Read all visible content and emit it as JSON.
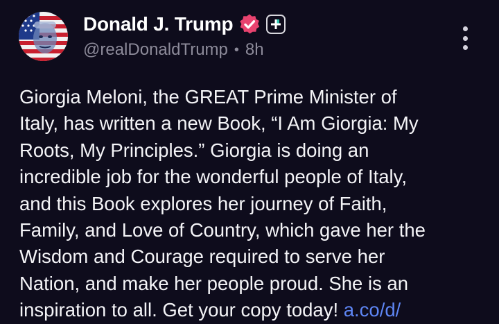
{
  "post": {
    "author_name": "Donald J. Trump",
    "handle": "@realDonaldTrump",
    "separator": "•",
    "time": "8h",
    "body_text": "Giorgia Meloni, the GREAT Prime Minister of\nItaly, has written a new Book, “I Am Giorgia: My\nRoots, My Principles.” Giorgia is doing an\nincredible job for the wonderful people of Italy,\nand this Book explores her journey of Faith,\nFamily, and Love of Country, which gave her the\nWisdom and Courage required to serve her\nNation, and make her people proud. She is an\ninspiration to all. Get your copy today! ",
    "link_text": "a.co/d/"
  },
  "icons": {
    "verified": "verified-badge-icon",
    "plus": "plus-icon",
    "more": "more-options-icon"
  },
  "colors": {
    "background": "#0e0c1c",
    "verified": "#e8436f",
    "link": "#5e86f5",
    "muted_text": "#8d8b9a"
  }
}
